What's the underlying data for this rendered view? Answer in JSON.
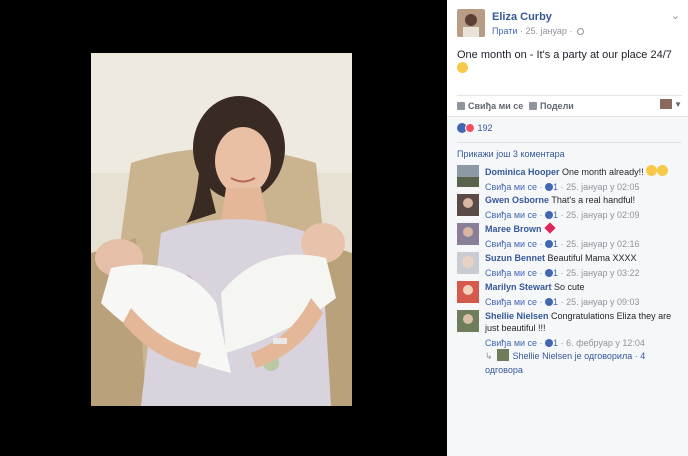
{
  "post": {
    "author": "Eliza Curby",
    "follow_label": "Прати",
    "date": "25. јануар",
    "text": "One month on - It's a party at our place 24/7",
    "emoji_icon": "smiling-face-icon"
  },
  "actions": {
    "like_label": "Свиђа ми се",
    "share_label": "Подели"
  },
  "reactions": {
    "count": "192"
  },
  "comments": {
    "more_label": "Прикажи још 3 коментара",
    "items": [
      {
        "name": "Dominica Hooper",
        "text": "One month already!!",
        "like_label": "Свиђа ми се",
        "likes": "1",
        "time": "25. јануар у 02:05"
      },
      {
        "name": "Gwen Osborne",
        "text": "That's a real handful!",
        "like_label": "Свиђа ми се",
        "likes": "1",
        "time": "25. јануар у 02:09"
      },
      {
        "name": "Maree Brown",
        "text": "",
        "like_label": "Свиђа ми се",
        "likes": "1",
        "time": "25. јануар у 02:16"
      },
      {
        "name": "Suzun Bennet",
        "text": "Beautiful Mama XXXX",
        "like_label": "Свиђа ми се",
        "likes": "1",
        "time": "25. јануар у 03:22"
      },
      {
        "name": "Marilyn Stewart",
        "text": "So cute",
        "like_label": "Свиђа ми се",
        "likes": "1",
        "time": "25. јануар у 09:03"
      },
      {
        "name": "Shellie Nielsen",
        "text": "Congratulations Eliza they are just beautiful !!!",
        "like_label": "Свиђа ми се",
        "likes": "1",
        "time": "6. фебруар у 12:04"
      }
    ],
    "reply_summary": "Shellie Nielsen је одговорила · 4 одговора"
  },
  "colors": {
    "link": "#365899",
    "accent": "#4267b2",
    "muted": "#90949c",
    "panel_bg": "#f6f7f9",
    "love": "#f25268"
  }
}
